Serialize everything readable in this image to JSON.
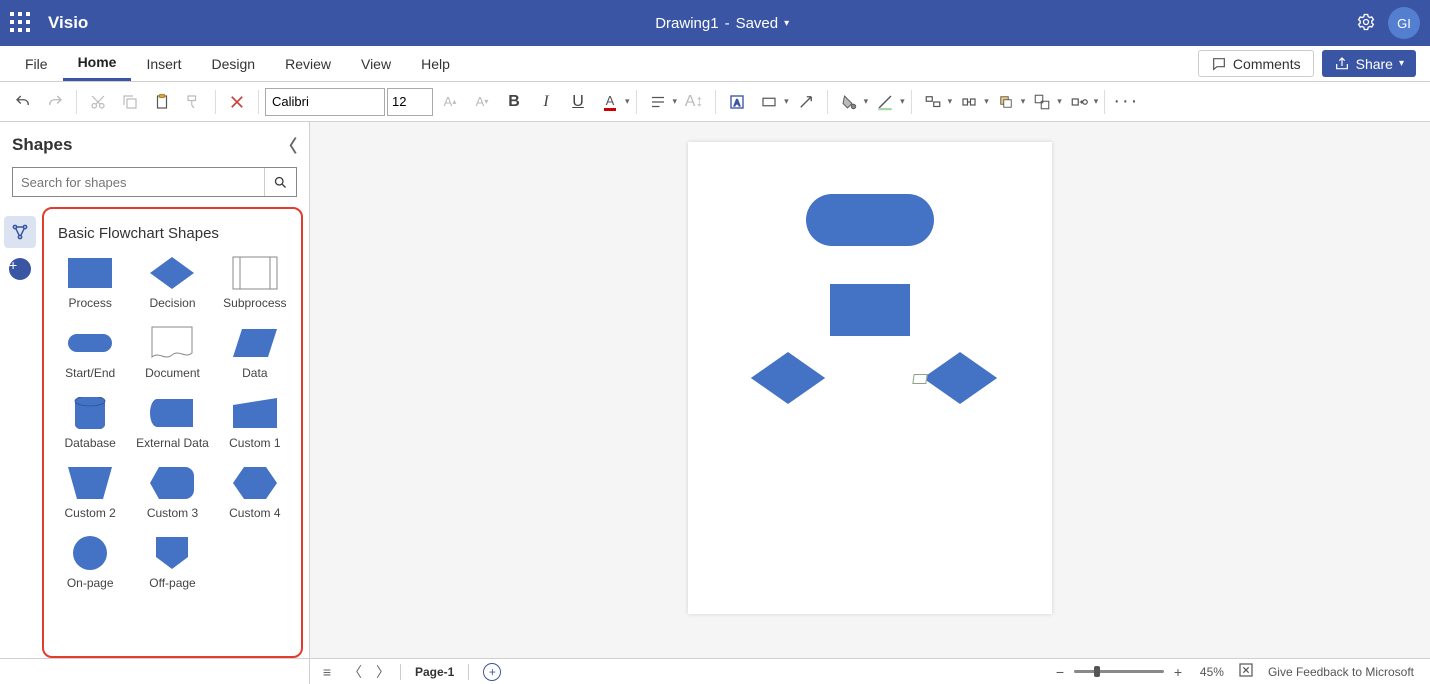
{
  "app": {
    "name": "Visio",
    "avatar_initials": "GI"
  },
  "title": {
    "doc": "Drawing1",
    "sep": " - ",
    "status": "Saved"
  },
  "menubar": {
    "tabs": [
      "File",
      "Home",
      "Insert",
      "Design",
      "Review",
      "View",
      "Help"
    ],
    "active_index": 1,
    "comments": "Comments",
    "share": "Share"
  },
  "toolbar": {
    "font": "Calibri",
    "font_size": "12"
  },
  "shapes_pane": {
    "title": "Shapes",
    "search_placeholder": "Search for shapes",
    "stencil_title": "Basic Flowchart Shapes",
    "shapes": [
      {
        "label": "Process",
        "kind": "process"
      },
      {
        "label": "Decision",
        "kind": "decision"
      },
      {
        "label": "Subprocess",
        "kind": "subprocess"
      },
      {
        "label": "Start/End",
        "kind": "startend"
      },
      {
        "label": "Document",
        "kind": "document"
      },
      {
        "label": "Data",
        "kind": "data"
      },
      {
        "label": "Database",
        "kind": "database"
      },
      {
        "label": "External Data",
        "kind": "externaldata"
      },
      {
        "label": "Custom 1",
        "kind": "custom1"
      },
      {
        "label": "Custom 2",
        "kind": "custom2"
      },
      {
        "label": "Custom 3",
        "kind": "custom3"
      },
      {
        "label": "Custom 4",
        "kind": "custom4"
      },
      {
        "label": "On-page",
        "kind": "onpage"
      },
      {
        "label": "Off-page",
        "kind": "offpage"
      }
    ]
  },
  "pagebar": {
    "page_tab": "Page-1"
  },
  "status": {
    "zoom": "45%",
    "feedback": "Give Feedback to Microsoft"
  },
  "colors": {
    "accent": "#3955a3",
    "shape_fill": "#4472c4",
    "highlight_border": "#e33b2e"
  }
}
